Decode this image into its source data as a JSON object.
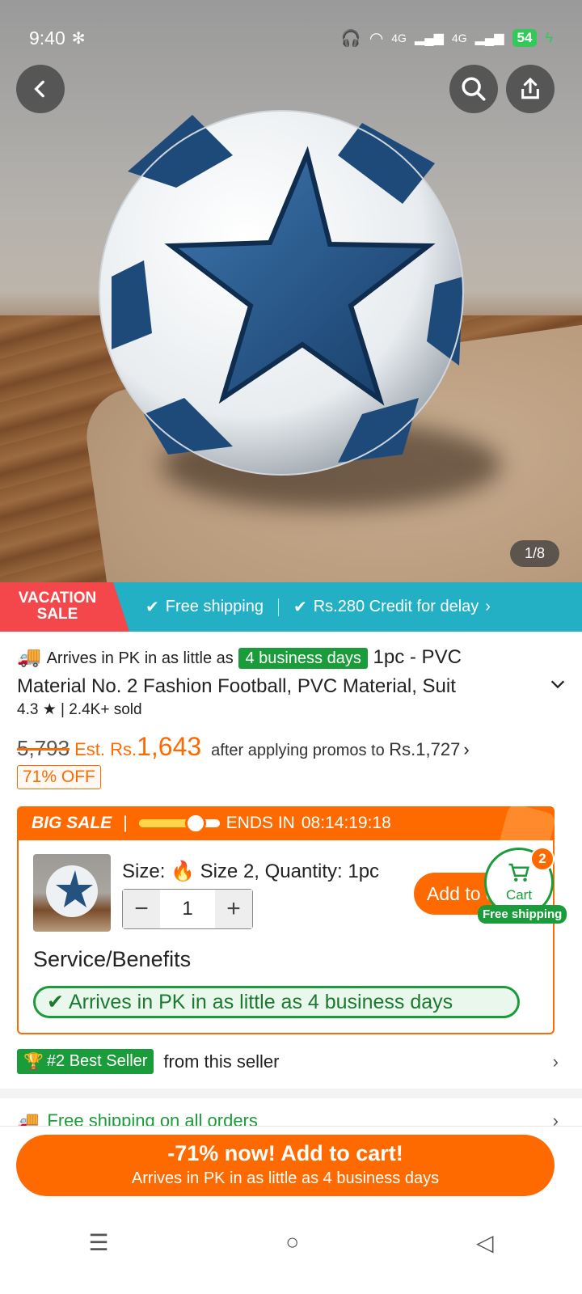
{
  "status": {
    "time": "9:40",
    "battery": "54",
    "net1": "4G",
    "net2": "4G"
  },
  "hero": {
    "pager": "1/8"
  },
  "promo": {
    "vacation_line1": "VACATION",
    "vacation_line2": "SALE",
    "free_shipping": "Free shipping",
    "credit": "Rs.280 Credit for delay"
  },
  "product": {
    "arrives_prefix": "Arrives in PK in as little as",
    "arrives_badge": "4 business days",
    "title_part1": "1pc - PVC",
    "title_line2": "Material No. 2 Fashion Football, PVC Material, Suit",
    "rating": "4.3",
    "sold": "2.4K+ sold",
    "old_price": "5,793",
    "est_label": "Est. Rs.",
    "est_price": "1,643",
    "after_text": "after applying promos to",
    "after_price": "Rs.1,727",
    "discount": "71% OFF"
  },
  "sale": {
    "label": "BIG SALE",
    "progress": 0.7,
    "ends_in": "ENDS IN",
    "countdown": "08:14:19:18",
    "size_label": "Size:",
    "size_value": "Size 2, Quantity: 1pc",
    "quantity": "1",
    "add_to_cart": "Add to cart",
    "cart_label": "Cart",
    "cart_count": "2",
    "free_shipping_tag": "Free shipping",
    "service_title": "Service/Benefits",
    "service_pill": "Arrives in PK in as little as 4 business days"
  },
  "seller": {
    "badge": "#2 Best Seller",
    "text": "from this seller"
  },
  "free_all": "Free shipping on all orders",
  "cta": {
    "line1": "-71% now! Add to cart!",
    "line2": "Arrives in PK in as little as 4 business days"
  },
  "colors": {
    "accent": "#ff6a00",
    "green": "#1b9c3a",
    "teal": "#23b0c4",
    "red": "#f4474b"
  }
}
